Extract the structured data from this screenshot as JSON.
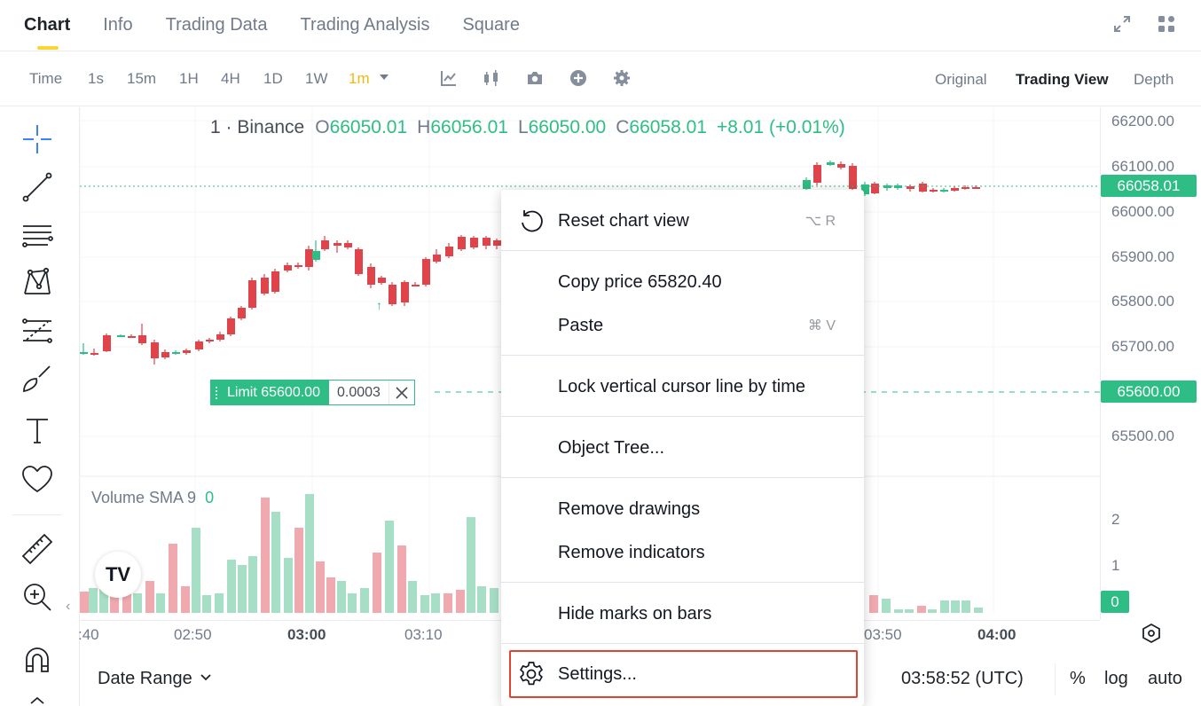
{
  "tabs": [
    {
      "label": "Chart",
      "active": true
    },
    {
      "label": "Info",
      "active": false
    },
    {
      "label": "Trading Data",
      "active": false
    },
    {
      "label": "Trading Analysis",
      "active": false
    },
    {
      "label": "Square",
      "active": false
    }
  ],
  "tab_icons": [
    "expand-icon",
    "layout-grid-icon"
  ],
  "toolbar": {
    "intervals": [
      "Time",
      "1s",
      "15m",
      "1H",
      "4H",
      "1D",
      "1W"
    ],
    "selected_interval": "1m",
    "tool_icons": [
      "indicators-icon",
      "candle-type-icon",
      "camera-icon",
      "add-icon",
      "gear-icon"
    ],
    "views": [
      {
        "label": "Original",
        "active": false
      },
      {
        "label": "Trading View",
        "active": true
      },
      {
        "label": "Depth",
        "active": false
      }
    ]
  },
  "legend": {
    "symbol": "1 · Binance",
    "o_label": "O",
    "o": "66050.01",
    "h_label": "H",
    "h": "66056.01",
    "l_label": "L",
    "l": "66050.00",
    "c_label": "C",
    "c": "66058.01",
    "change": "+8.01 (+0.01%)"
  },
  "price_axis": {
    "labels": [
      "66200.00",
      "66100.00",
      "66000.00",
      "65900.00",
      "65800.00",
      "65700.00",
      "65500.00"
    ],
    "last_price": "66058.01",
    "limit_price": "65600.00",
    "volume_labels": [
      "2",
      "1"
    ],
    "volume_last": "0"
  },
  "order": {
    "label": "Limit 65600.00",
    "qty": "0.0003"
  },
  "volume_legend": {
    "label": "Volume SMA 9",
    "value": "0"
  },
  "time_axis": [
    {
      "label": ":40",
      "bold": false
    },
    {
      "label": "02:50",
      "bold": false
    },
    {
      "label": "03:00",
      "bold": true
    },
    {
      "label": "03:10",
      "bold": false
    },
    {
      "label": "03:50",
      "bold": false
    },
    {
      "label": "04:00",
      "bold": true
    }
  ],
  "bottom": {
    "date_range": "Date Range",
    "clock": "03:58:52 (UTC)",
    "options": [
      "%",
      "log",
      "auto"
    ]
  },
  "tv_logo": "TV",
  "context_menu": {
    "reset": {
      "label": "Reset chart view",
      "shortcut": "⌥ R"
    },
    "copy_price": {
      "label": "Copy price 65820.40"
    },
    "paste": {
      "label": "Paste",
      "shortcut": "⌘ V"
    },
    "lock_cursor": {
      "label": "Lock vertical cursor line by time"
    },
    "object_tree": {
      "label": "Object Tree..."
    },
    "remove_drawings": {
      "label": "Remove drawings"
    },
    "remove_indicators": {
      "label": "Remove indicators"
    },
    "hide_marks": {
      "label": "Hide marks on bars"
    },
    "settings": {
      "label": "Settings..."
    }
  },
  "colors": {
    "up": "#2ebd85",
    "down": "#e0434a",
    "accent": "#f0b90b",
    "highlight": "#e0432f"
  }
}
